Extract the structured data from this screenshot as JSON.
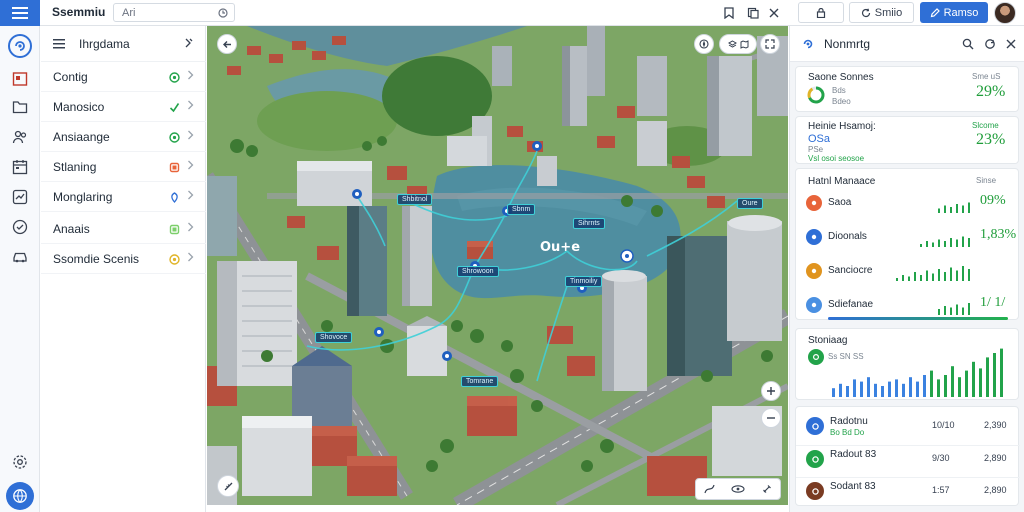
{
  "app": {
    "title": "Ssemmiu",
    "search_value": "Ari",
    "button_one": "",
    "button_two": "Smiio",
    "primary_button": "Ramso"
  },
  "menu": {
    "title": "Ihrgdama",
    "items": [
      {
        "label": "Contig",
        "status": "circle",
        "status_color": "#22a34a"
      },
      {
        "label": "Manosico",
        "status": "check",
        "status_color": "#22a34a"
      },
      {
        "label": "Ansiaange",
        "status": "circle",
        "status_color": "#22a34a"
      },
      {
        "label": "Stlaning",
        "status": "square",
        "status_color": "#e8643a"
      },
      {
        "label": "Monglaring",
        "status": "pin",
        "status_color": "#2f6fd6"
      },
      {
        "label": "Anaais",
        "status": "square",
        "status_color": "#7ccf6a"
      },
      {
        "label": "Ssomdie Scenis",
        "status": "circle",
        "status_color": "#e0b428"
      }
    ]
  },
  "map": {
    "labels": [
      "Shbitnol",
      "Sbnm",
      "Sihrnts",
      "Shrowoon",
      "Tinmoiliy",
      "Shovoce",
      "Tomrane",
      "Oure"
    ],
    "center_label": "Ou+e"
  },
  "panel": {
    "title": "Nonmrtg",
    "kpis": [
      {
        "title": "Saone Sonnes",
        "sub": "Bds",
        "sub2": "Bdeo",
        "right_small": "Sme uS",
        "value": "29%",
        "color": "#e0b428"
      },
      {
        "title": "Heinie Hsamoj:",
        "sub": "OSa",
        "sub2": "PSe",
        "sub3": "Vsl osoi seosoe",
        "right_small": "Slcome",
        "value": "23%",
        "color": "#2f6fd6"
      }
    ],
    "list": {
      "title": "Hatnl Manaace",
      "right_small": "Sinse",
      "rows": [
        {
          "label": "Saoa",
          "value": "09%",
          "color": "#e8643a"
        },
        {
          "label": "Dioonals",
          "value": "1,83%",
          "color": "#2f6fd6"
        },
        {
          "label": "Sanciocre",
          "value": "",
          "color": "#e0941f"
        },
        {
          "label": "Sdiefanae",
          "value": "1/ 1/",
          "color": "#4a90e2"
        }
      ]
    },
    "chart": {
      "title": "Stoniaag",
      "sub": "Ss SN SS"
    },
    "table": [
      {
        "label": "Radotnu",
        "sub": "Bo Bd Do",
        "col1": "10/10",
        "col2": "2,390",
        "color": "#2f6fd6"
      },
      {
        "label": "Radout 83",
        "sub": "",
        "col1": "9/30",
        "col2": "2,890",
        "color": "#22a34a"
      },
      {
        "label": "Sodant 83",
        "sub": "",
        "col1": "1:57",
        "col2": "2,890",
        "color": "#7a3b22"
      }
    ]
  },
  "colors": {
    "accent": "#2f6fd6",
    "green": "#22a34a"
  }
}
